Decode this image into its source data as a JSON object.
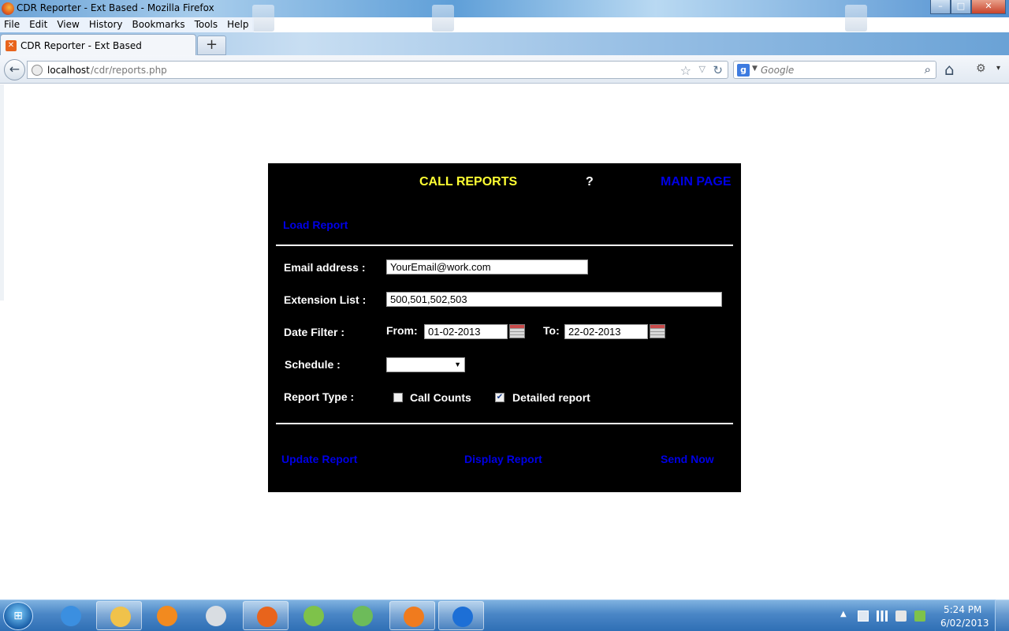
{
  "window": {
    "title": "CDR Reporter - Ext Based - Mozilla Firefox",
    "minimize_symbol": "–",
    "maximize_symbol": "□",
    "close_symbol": "✕"
  },
  "menu": {
    "items": [
      "File",
      "Edit",
      "View",
      "History",
      "Bookmarks",
      "Tools",
      "Help"
    ]
  },
  "tabs": {
    "active_label": "CDR Reporter - Ext Based",
    "favicon_glyph": "✕",
    "new_tab_symbol": "+"
  },
  "nav": {
    "back_symbol": "←",
    "url_host": "localhost",
    "url_path": "/cdr/reports.php",
    "star_symbol": "☆",
    "dropdown_symbol": "▽",
    "reload_symbol": "↻",
    "search_engine_glyph": "g",
    "search_dropdown_symbol": "▼",
    "search_placeholder": "Google",
    "search_symbol": "⌕",
    "home_symbol": "⌂",
    "addon_symbol": "⚙",
    "menu_dropdown_symbol": "▾"
  },
  "report_panel": {
    "heading": "CALL REPORTS",
    "help_link": "?",
    "main_page_link": "MAIN PAGE",
    "load_report_link": "Load Report",
    "email_label": "Email address :",
    "email_value": "YourEmail@work.com",
    "extension_label": "Extension List :",
    "extension_value": "500,501,502,503",
    "date_filter_label": "Date Filter :",
    "from_label": "From:",
    "from_value": "01-02-2013",
    "to_label": "To:",
    "to_value": "22-02-2013",
    "schedule_label": "Schedule :",
    "schedule_value": "",
    "schedule_caret": "▼",
    "report_type_label": "Report Type :",
    "call_counts_label": "Call Counts",
    "call_counts_checked": false,
    "detailed_report_label": "Detailed report",
    "detailed_report_checked": true,
    "detailed_check_mark": "✔",
    "actions": {
      "update": "Update Report",
      "display": "Display Report",
      "send": "Send Now"
    }
  },
  "taskbar": {
    "start_glyph": "⊞",
    "apps": [
      {
        "name": "internet-explorer",
        "color": "#3b8fe0",
        "running": false
      },
      {
        "name": "file-explorer",
        "color": "#f0c24b",
        "running": true
      },
      {
        "name": "media-player",
        "color": "#f28a1f",
        "running": false
      },
      {
        "name": "clock-app",
        "color": "#d9dde2",
        "running": false
      },
      {
        "name": "firefox",
        "color": "#e8641c",
        "running": true
      },
      {
        "name": "xampp-cross",
        "color": "#7ec24a",
        "running": false
      },
      {
        "name": "users-app",
        "color": "#6dbb5a",
        "running": false
      },
      {
        "name": "xampp",
        "color": "#f07b1e",
        "running": true
      },
      {
        "name": "teamviewer",
        "color": "#1d6fd6",
        "running": true
      }
    ],
    "tray_expand_symbol": "▲",
    "clock_time": "5:24 PM",
    "clock_date": "6/02/2013"
  }
}
